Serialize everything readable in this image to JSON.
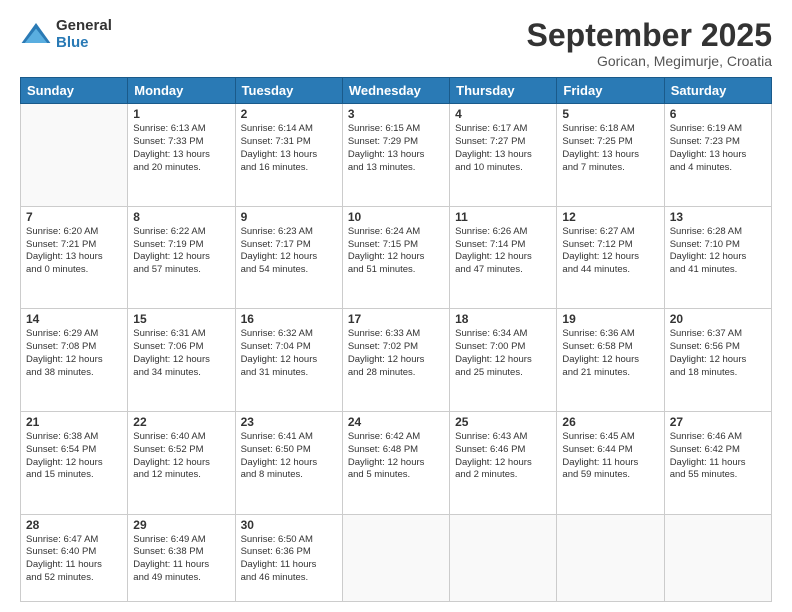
{
  "logo": {
    "general": "General",
    "blue": "Blue"
  },
  "title": "September 2025",
  "subtitle": "Gorican, Megimurje, Croatia",
  "days_of_week": [
    "Sunday",
    "Monday",
    "Tuesday",
    "Wednesday",
    "Thursday",
    "Friday",
    "Saturday"
  ],
  "weeks": [
    [
      {
        "day": "",
        "info": ""
      },
      {
        "day": "1",
        "info": "Sunrise: 6:13 AM\nSunset: 7:33 PM\nDaylight: 13 hours\nand 20 minutes."
      },
      {
        "day": "2",
        "info": "Sunrise: 6:14 AM\nSunset: 7:31 PM\nDaylight: 13 hours\nand 16 minutes."
      },
      {
        "day": "3",
        "info": "Sunrise: 6:15 AM\nSunset: 7:29 PM\nDaylight: 13 hours\nand 13 minutes."
      },
      {
        "day": "4",
        "info": "Sunrise: 6:17 AM\nSunset: 7:27 PM\nDaylight: 13 hours\nand 10 minutes."
      },
      {
        "day": "5",
        "info": "Sunrise: 6:18 AM\nSunset: 7:25 PM\nDaylight: 13 hours\nand 7 minutes."
      },
      {
        "day": "6",
        "info": "Sunrise: 6:19 AM\nSunset: 7:23 PM\nDaylight: 13 hours\nand 4 minutes."
      }
    ],
    [
      {
        "day": "7",
        "info": "Sunrise: 6:20 AM\nSunset: 7:21 PM\nDaylight: 13 hours\nand 0 minutes."
      },
      {
        "day": "8",
        "info": "Sunrise: 6:22 AM\nSunset: 7:19 PM\nDaylight: 12 hours\nand 57 minutes."
      },
      {
        "day": "9",
        "info": "Sunrise: 6:23 AM\nSunset: 7:17 PM\nDaylight: 12 hours\nand 54 minutes."
      },
      {
        "day": "10",
        "info": "Sunrise: 6:24 AM\nSunset: 7:15 PM\nDaylight: 12 hours\nand 51 minutes."
      },
      {
        "day": "11",
        "info": "Sunrise: 6:26 AM\nSunset: 7:14 PM\nDaylight: 12 hours\nand 47 minutes."
      },
      {
        "day": "12",
        "info": "Sunrise: 6:27 AM\nSunset: 7:12 PM\nDaylight: 12 hours\nand 44 minutes."
      },
      {
        "day": "13",
        "info": "Sunrise: 6:28 AM\nSunset: 7:10 PM\nDaylight: 12 hours\nand 41 minutes."
      }
    ],
    [
      {
        "day": "14",
        "info": "Sunrise: 6:29 AM\nSunset: 7:08 PM\nDaylight: 12 hours\nand 38 minutes."
      },
      {
        "day": "15",
        "info": "Sunrise: 6:31 AM\nSunset: 7:06 PM\nDaylight: 12 hours\nand 34 minutes."
      },
      {
        "day": "16",
        "info": "Sunrise: 6:32 AM\nSunset: 7:04 PM\nDaylight: 12 hours\nand 31 minutes."
      },
      {
        "day": "17",
        "info": "Sunrise: 6:33 AM\nSunset: 7:02 PM\nDaylight: 12 hours\nand 28 minutes."
      },
      {
        "day": "18",
        "info": "Sunrise: 6:34 AM\nSunset: 7:00 PM\nDaylight: 12 hours\nand 25 minutes."
      },
      {
        "day": "19",
        "info": "Sunrise: 6:36 AM\nSunset: 6:58 PM\nDaylight: 12 hours\nand 21 minutes."
      },
      {
        "day": "20",
        "info": "Sunrise: 6:37 AM\nSunset: 6:56 PM\nDaylight: 12 hours\nand 18 minutes."
      }
    ],
    [
      {
        "day": "21",
        "info": "Sunrise: 6:38 AM\nSunset: 6:54 PM\nDaylight: 12 hours\nand 15 minutes."
      },
      {
        "day": "22",
        "info": "Sunrise: 6:40 AM\nSunset: 6:52 PM\nDaylight: 12 hours\nand 12 minutes."
      },
      {
        "day": "23",
        "info": "Sunrise: 6:41 AM\nSunset: 6:50 PM\nDaylight: 12 hours\nand 8 minutes."
      },
      {
        "day": "24",
        "info": "Sunrise: 6:42 AM\nSunset: 6:48 PM\nDaylight: 12 hours\nand 5 minutes."
      },
      {
        "day": "25",
        "info": "Sunrise: 6:43 AM\nSunset: 6:46 PM\nDaylight: 12 hours\nand 2 minutes."
      },
      {
        "day": "26",
        "info": "Sunrise: 6:45 AM\nSunset: 6:44 PM\nDaylight: 11 hours\nand 59 minutes."
      },
      {
        "day": "27",
        "info": "Sunrise: 6:46 AM\nSunset: 6:42 PM\nDaylight: 11 hours\nand 55 minutes."
      }
    ],
    [
      {
        "day": "28",
        "info": "Sunrise: 6:47 AM\nSunset: 6:40 PM\nDaylight: 11 hours\nand 52 minutes."
      },
      {
        "day": "29",
        "info": "Sunrise: 6:49 AM\nSunset: 6:38 PM\nDaylight: 11 hours\nand 49 minutes."
      },
      {
        "day": "30",
        "info": "Sunrise: 6:50 AM\nSunset: 6:36 PM\nDaylight: 11 hours\nand 46 minutes."
      },
      {
        "day": "",
        "info": ""
      },
      {
        "day": "",
        "info": ""
      },
      {
        "day": "",
        "info": ""
      },
      {
        "day": "",
        "info": ""
      }
    ]
  ]
}
